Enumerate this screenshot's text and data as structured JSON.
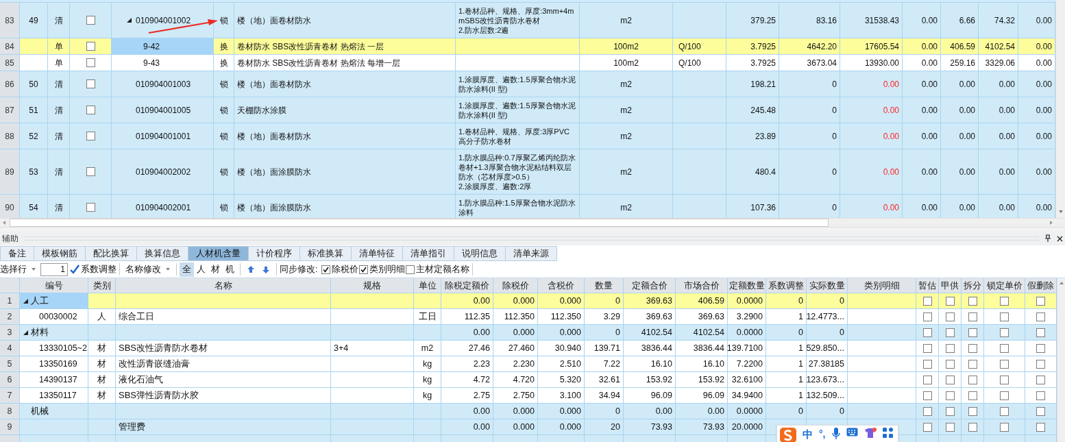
{
  "top_table": {
    "rows": [
      {
        "row_header": "83",
        "column_1": "49",
        "column_2": "清",
        "checked": false,
        "expanded": true,
        "column_4": "010904001002",
        "column_5": "锁",
        "column_6": "楼（地）面卷材防水",
        "column_7": "1.卷材品种、规格、厚度:3mm+4mmSBS改性沥青防水卷材\n2.防水层数:2遍",
        "column_8": "m2",
        "column_10": "379.25",
        "column_11": "83.16",
        "column_12": "31538.43",
        "column_13": "0.00",
        "column_14": "6.66",
        "column_15": "74.32",
        "column_16": "0.00",
        "kind": "bill",
        "selected": false,
        "flagged": false
      },
      {
        "row_header": "84",
        "column_2": "单",
        "checked": false,
        "column_4": "9-42",
        "column_5": "换",
        "column_6": "卷材防水 SBS改性沥青卷材 热熔法 一层",
        "column_8": "100m2",
        "column_9": "Q/100",
        "column_10": "3.7925",
        "column_11": "4642.20",
        "column_12": "17605.54",
        "column_13": "0.00",
        "column_14": "406.59",
        "column_15": "4102.54",
        "column_16": "0.00",
        "kind": "quota",
        "selected": true,
        "flagged": false
      },
      {
        "row_header": "85",
        "column_2": "单",
        "checked": false,
        "column_4": "9-43",
        "column_5": "换",
        "column_6": "卷材防水 SBS改性沥青卷材 热熔法 每增一层",
        "column_8": "100m2",
        "column_9": "Q/100",
        "column_10": "3.7925",
        "column_11": "3673.04",
        "column_12": "13930.00",
        "column_13": "0.00",
        "column_14": "259.16",
        "column_15": "3329.06",
        "column_16": "0.00",
        "kind": "quota",
        "selected": false,
        "flagged": false
      },
      {
        "row_header": "86",
        "column_1": "50",
        "column_2": "清",
        "checked": false,
        "column_4": "010904001003",
        "column_5": "锁",
        "column_6": "楼（地）面卷材防水",
        "column_7": "1.涂膜厚度、遍数:1.5厚聚合物水泥防水涂料(II 型)",
        "column_8": "m2",
        "column_10": "198.21",
        "column_11": "0",
        "column_12": "0.00",
        "column_13": "0.00",
        "column_14": "0.00",
        "column_15": "0.00",
        "column_16": "0.00",
        "kind": "bill",
        "selected": false,
        "flagged": true
      },
      {
        "row_header": "87",
        "column_1": "51",
        "column_2": "清",
        "checked": false,
        "column_4": "010904001005",
        "column_5": "锁",
        "column_6": "天棚防水涂膜",
        "column_7": "1.涂膜厚度、遍数:1.5厚聚合物水泥防水涂料(II 型)",
        "column_8": "m2",
        "column_10": "245.48",
        "column_11": "0",
        "column_12": "0.00",
        "column_13": "0.00",
        "column_14": "0.00",
        "column_15": "0.00",
        "column_16": "0.00",
        "kind": "bill",
        "selected": false,
        "flagged": true
      },
      {
        "row_header": "88",
        "column_1": "52",
        "column_2": "清",
        "checked": false,
        "column_4": "010904001001",
        "column_5": "锁",
        "column_6": "楼（地）面卷材防水",
        "column_7": "1.卷材品种、规格、厚度:3厚PVC 高分子防水卷材",
        "column_8": "m2",
        "column_10": "23.89",
        "column_11": "0",
        "column_12": "0.00",
        "column_13": "0.00",
        "column_14": "0.00",
        "column_15": "0.00",
        "column_16": "0.00",
        "kind": "bill",
        "selected": false,
        "flagged": true
      },
      {
        "row_header": "89",
        "column_1": "53",
        "column_2": "清",
        "checked": false,
        "column_4": "010904002002",
        "column_5": "锁",
        "column_6": "楼（地）面涂膜防水",
        "column_7": "1.防水膜品种:0.7厚聚乙烯丙纶防水卷材+1.3厚聚合物水泥粘结料双层防水（芯材厚度>0.5）\n2.涂膜厚度、遍数:2厚",
        "column_8": "m2",
        "column_10": "480.4",
        "column_11": "0",
        "column_12": "0.00",
        "column_13": "0.00",
        "column_14": "0.00",
        "column_15": "0.00",
        "column_16": "0.00",
        "kind": "bill",
        "selected": false,
        "flagged": true
      },
      {
        "row_header": "90",
        "column_1": "54",
        "column_2": "清",
        "checked": false,
        "column_4": "010904002001",
        "column_5": "锁",
        "column_6": "楼（地）面涂膜防水",
        "column_7": "1.防水膜品种:1.5厚聚合物水泥防水涂料",
        "column_8": "m2",
        "column_10": "107.36",
        "column_11": "0",
        "column_12": "0.00",
        "column_13": "0.00",
        "column_14": "0.00",
        "column_15": "0.00",
        "column_16": "0.00",
        "kind": "bill",
        "selected": false,
        "flagged": true
      }
    ]
  },
  "panel": {
    "title": "辅助"
  },
  "tabs": [
    {
      "label": "备注",
      "selected": false
    },
    {
      "label": "模板钢筋",
      "selected": false
    },
    {
      "label": "配比换算",
      "selected": false
    },
    {
      "label": "换算信息",
      "selected": false
    },
    {
      "label": "人材机含量",
      "selected": true
    },
    {
      "label": "计价程序",
      "selected": false
    },
    {
      "label": "标准换算",
      "selected": false
    },
    {
      "label": "清单特征",
      "selected": false
    },
    {
      "label": "清单指引",
      "selected": false
    },
    {
      "label": "说明信息",
      "selected": false
    },
    {
      "label": "清单来源",
      "selected": false
    }
  ],
  "toolbar": {
    "row_select": "选择行",
    "row_value": "1",
    "coefficient_button": "系数调整",
    "rename_dropdown": "名称修改",
    "filters": [
      {
        "label": "全",
        "selected": true
      },
      {
        "label": "人",
        "selected": false
      },
      {
        "label": "材",
        "selected": false
      },
      {
        "label": "机",
        "selected": false
      }
    ],
    "sync_label": "同步修改:",
    "sync_options": [
      {
        "label": "除税价",
        "checked": true
      },
      {
        "label": "类别明细",
        "checked": true
      },
      {
        "label": "主材定额名称",
        "checked": false
      }
    ]
  },
  "resource_table": {
    "columns": [
      "编号",
      "类别",
      "名称",
      "规格",
      "单位",
      "除税定额价",
      "除税价",
      "含税价",
      "数量",
      "定额合价",
      "市场合价",
      "定额数量",
      "系数调整",
      "实际数量",
      "类别明细",
      "暂估",
      "甲供",
      "拆分",
      "锁定单价",
      "假删除"
    ],
    "rows": [
      {
        "row_header": "1",
        "kind": "group",
        "selected": true,
        "expanded": true,
        "code": "人工",
        "base_price_ex_tax": "0.00",
        "price_ex_tax": "0.000",
        "price_inc_tax": "0.000",
        "quantity": "0",
        "base_total": "369.63",
        "market_total": "406.59",
        "base_quantity": "0.0000",
        "coefficient": "0",
        "actual_quantity": "0",
        "flags": [
          false,
          false,
          false,
          false,
          false
        ]
      },
      {
        "row_header": "2",
        "kind": "item",
        "selected": false,
        "code": "00030002",
        "category": "人",
        "name": "综合工日",
        "unit": "工日",
        "base_price_ex_tax": "112.35",
        "price_ex_tax": "112.350",
        "price_inc_tax": "112.350",
        "quantity": "3.29",
        "base_total": "369.63",
        "market_total": "369.63",
        "base_quantity": "3.2900",
        "coefficient": "1",
        "actual_quantity": "12.4773...",
        "flags": [
          false,
          false,
          false,
          false,
          false
        ]
      },
      {
        "row_header": "3",
        "kind": "group",
        "selected": false,
        "expanded": true,
        "code": "材料",
        "base_price_ex_tax": "0.00",
        "price_ex_tax": "0.000",
        "price_inc_tax": "0.000",
        "quantity": "0",
        "base_total": "4102.54",
        "market_total": "4102.54",
        "base_quantity": "0.0000",
        "coefficient": "0",
        "actual_quantity": "0",
        "flags": [
          false,
          false,
          false,
          false,
          false
        ]
      },
      {
        "row_header": "4",
        "kind": "item",
        "selected": false,
        "code": "13330105~2",
        "category": "材",
        "name": "SBS改性沥青防水卷材",
        "spec": "3+4",
        "unit": "m2",
        "base_price_ex_tax": "27.46",
        "price_ex_tax": "27.460",
        "price_inc_tax": "30.940",
        "quantity": "139.71",
        "base_total": "3836.44",
        "market_total": "3836.44",
        "base_quantity": "139.7100",
        "coefficient": "1",
        "actual_quantity": "529.850...",
        "flags": [
          false,
          false,
          false,
          false,
          false
        ]
      },
      {
        "row_header": "5",
        "kind": "item",
        "selected": false,
        "code": "13350169",
        "category": "材",
        "name": "改性沥青嵌缝油膏",
        "unit": "kg",
        "base_price_ex_tax": "2.23",
        "price_ex_tax": "2.230",
        "price_inc_tax": "2.510",
        "quantity": "7.22",
        "base_total": "16.10",
        "market_total": "16.10",
        "base_quantity": "7.2200",
        "coefficient": "1",
        "actual_quantity": "27.38185",
        "flags": [
          false,
          false,
          false,
          false,
          false
        ]
      },
      {
        "row_header": "6",
        "kind": "item",
        "selected": false,
        "code": "14390137",
        "category": "材",
        "name": "液化石油气",
        "unit": "kg",
        "base_price_ex_tax": "4.72",
        "price_ex_tax": "4.720",
        "price_inc_tax": "5.320",
        "quantity": "32.61",
        "base_total": "153.92",
        "market_total": "153.92",
        "base_quantity": "32.6100",
        "coefficient": "1",
        "actual_quantity": "123.673...",
        "flags": [
          false,
          false,
          false,
          false,
          false
        ]
      },
      {
        "row_header": "7",
        "kind": "item",
        "selected": false,
        "code": "13350117",
        "category": "材",
        "name": "SBS弹性沥青防水胶",
        "unit": "kg",
        "base_price_ex_tax": "2.75",
        "price_ex_tax": "2.750",
        "price_inc_tax": "3.100",
        "quantity": "34.94",
        "base_total": "96.09",
        "market_total": "96.09",
        "base_quantity": "34.9400",
        "coefficient": "1",
        "actual_quantity": "132.509...",
        "flags": [
          false,
          false,
          false,
          false,
          false
        ]
      },
      {
        "row_header": "8",
        "kind": "group",
        "selected": false,
        "code": "机械",
        "base_price_ex_tax": "0.00",
        "price_ex_tax": "0.000",
        "price_inc_tax": "0.000",
        "quantity": "0",
        "base_total": "0.00",
        "market_total": "0.00",
        "base_quantity": "0.0000",
        "coefficient": "0",
        "actual_quantity": "0",
        "flags": [
          false,
          false,
          false,
          false,
          false
        ]
      },
      {
        "row_header": "9",
        "kind": "group",
        "selected": false,
        "name": "管理费",
        "base_price_ex_tax": "0.00",
        "price_ex_tax": "0.000",
        "price_inc_tax": "0.000",
        "quantity": "20",
        "base_total": "73.93",
        "market_total": "73.93",
        "base_quantity": "20.0000",
        "flags": [
          false,
          false,
          false,
          false,
          false
        ]
      }
    ]
  },
  "ime_toolbar": {
    "mode": "中",
    "punctuation": "°,"
  }
}
